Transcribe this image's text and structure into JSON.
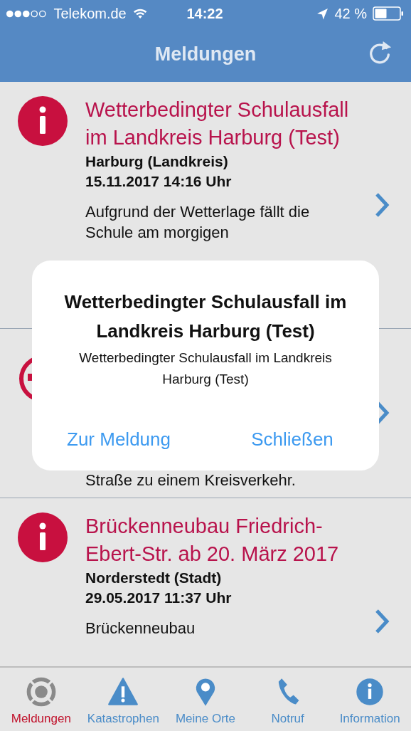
{
  "status_bar": {
    "carrier": "Telekom.de",
    "time": "14:22",
    "battery": "42 %"
  },
  "nav_bar": {
    "title": "Meldungen"
  },
  "messages": [
    {
      "title": "Wetterbedingter Schulausfall im Landkreis Harburg (Test)",
      "region": "Harburg (Landkreis)",
      "date": "15.11.2017 14:16 Uhr",
      "body": "Aufgrund der Wetterlage fällt die Schule am morgigen"
    },
    {
      "body": "Straße zu einem Kreisverkehr."
    },
    {
      "title": "Brückenneubau Friedrich-Ebert-Str. ab 20. März 2017",
      "region": "Norderstedt (Stadt)",
      "date": "29.05.2017 11:37 Uhr",
      "body": "Brückenneubau"
    }
  ],
  "alert": {
    "title": "Wetterbedingter Schulausfall im Landkreis Harburg (Test)",
    "message": "Wetterbedingter Schulausfall im Landkreis Harburg (Test)",
    "buttons": [
      "Zur Meldung",
      "Schließen"
    ]
  },
  "tab_bar": [
    {
      "label": "Meldungen",
      "selected": true
    },
    {
      "label": "Katastrophen",
      "selected": false
    },
    {
      "label": "Meine Orte",
      "selected": false
    },
    {
      "label": "Notruf",
      "selected": false
    },
    {
      "label": "Information",
      "selected": false
    }
  ]
}
